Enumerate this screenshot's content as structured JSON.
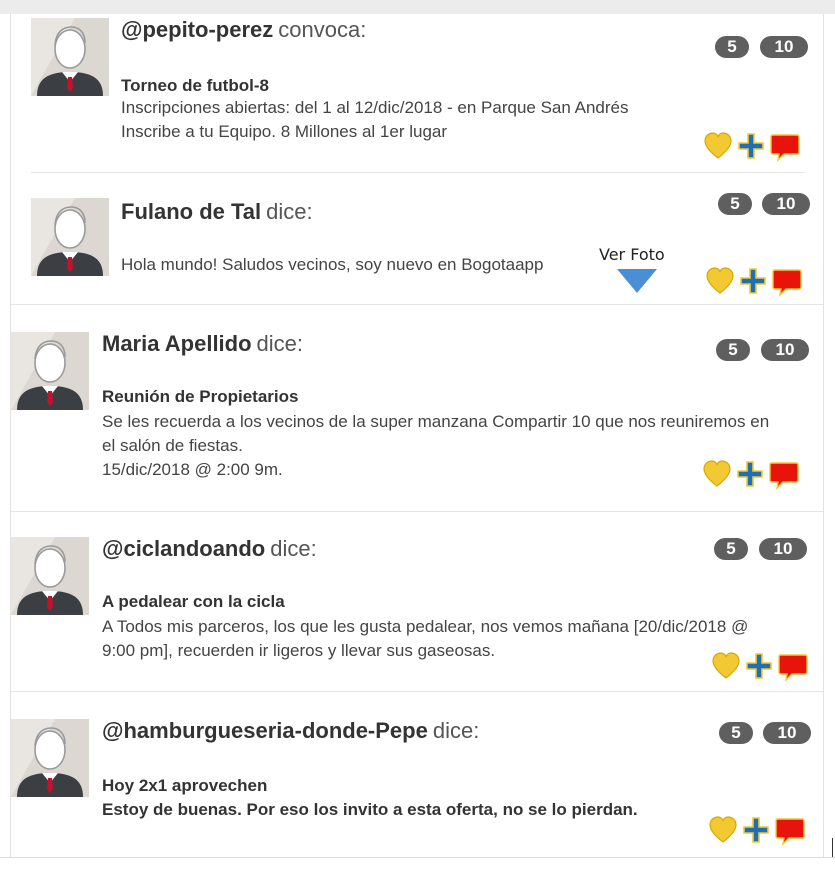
{
  "colors": {
    "badge_bg": "#5f5f5f",
    "heart": "#f2c932",
    "plus": "#1f6fb6",
    "comment": "#e8130b",
    "arrow": "#4a8fd4"
  },
  "icons": {
    "like": "heart-icon",
    "add": "plus-icon",
    "comment": "speech-bubble-icon",
    "avatar": "user-avatar-placeholder"
  },
  "posts": [
    {
      "author": "@pepito-perez",
      "verb": "convoca:",
      "subject": "Torneo de futbol-8",
      "lines": [
        "Inscripciones abiertas: del 1 al 12/dic/2018 - en Parque San Andrés",
        "Inscribe a tu Equipo. 8 Millones al 1er lugar"
      ],
      "count_a": "5",
      "count_b": "10"
    },
    {
      "author": "Fulano de Tal",
      "verb": "dice:",
      "subject": "",
      "lines": [
        "Hola mundo! Saludos vecinos, soy nuevo en Bogotaapp"
      ],
      "count_a": "5",
      "count_b": "10",
      "photo_label": "Ver Foto"
    },
    {
      "author": "Maria Apellido",
      "verb": "dice:",
      "subject": "Reunión de Propietarios",
      "lines": [
        "Se les recuerda a los vecinos de la super manzana Compartir 10 que nos reuniremos en",
        "el salón de fiestas.",
        "15/dic/2018 @ 2:00 9m."
      ],
      "count_a": "5",
      "count_b": "10"
    },
    {
      "author": "@ciclandoando",
      "verb": "dice:",
      "subject": "A pedalear con la cicla",
      "lines": [
        "A Todos mis parceros, los que les gusta pedalear, nos vemos mañana [20/dic/2018 @",
        "9:00 pm], recuerden ir ligeros y llevar sus gaseosas."
      ],
      "count_a": "5",
      "count_b": "10"
    },
    {
      "author": "@hamburgueseria-donde-Pepe",
      "verb": "dice:",
      "subject": "Hoy 2x1 aprovechen",
      "lines": [
        "Estoy de buenas. Por eso los invito a esta oferta, no se lo pierdan."
      ],
      "count_a": "5",
      "count_b": "10"
    }
  ]
}
